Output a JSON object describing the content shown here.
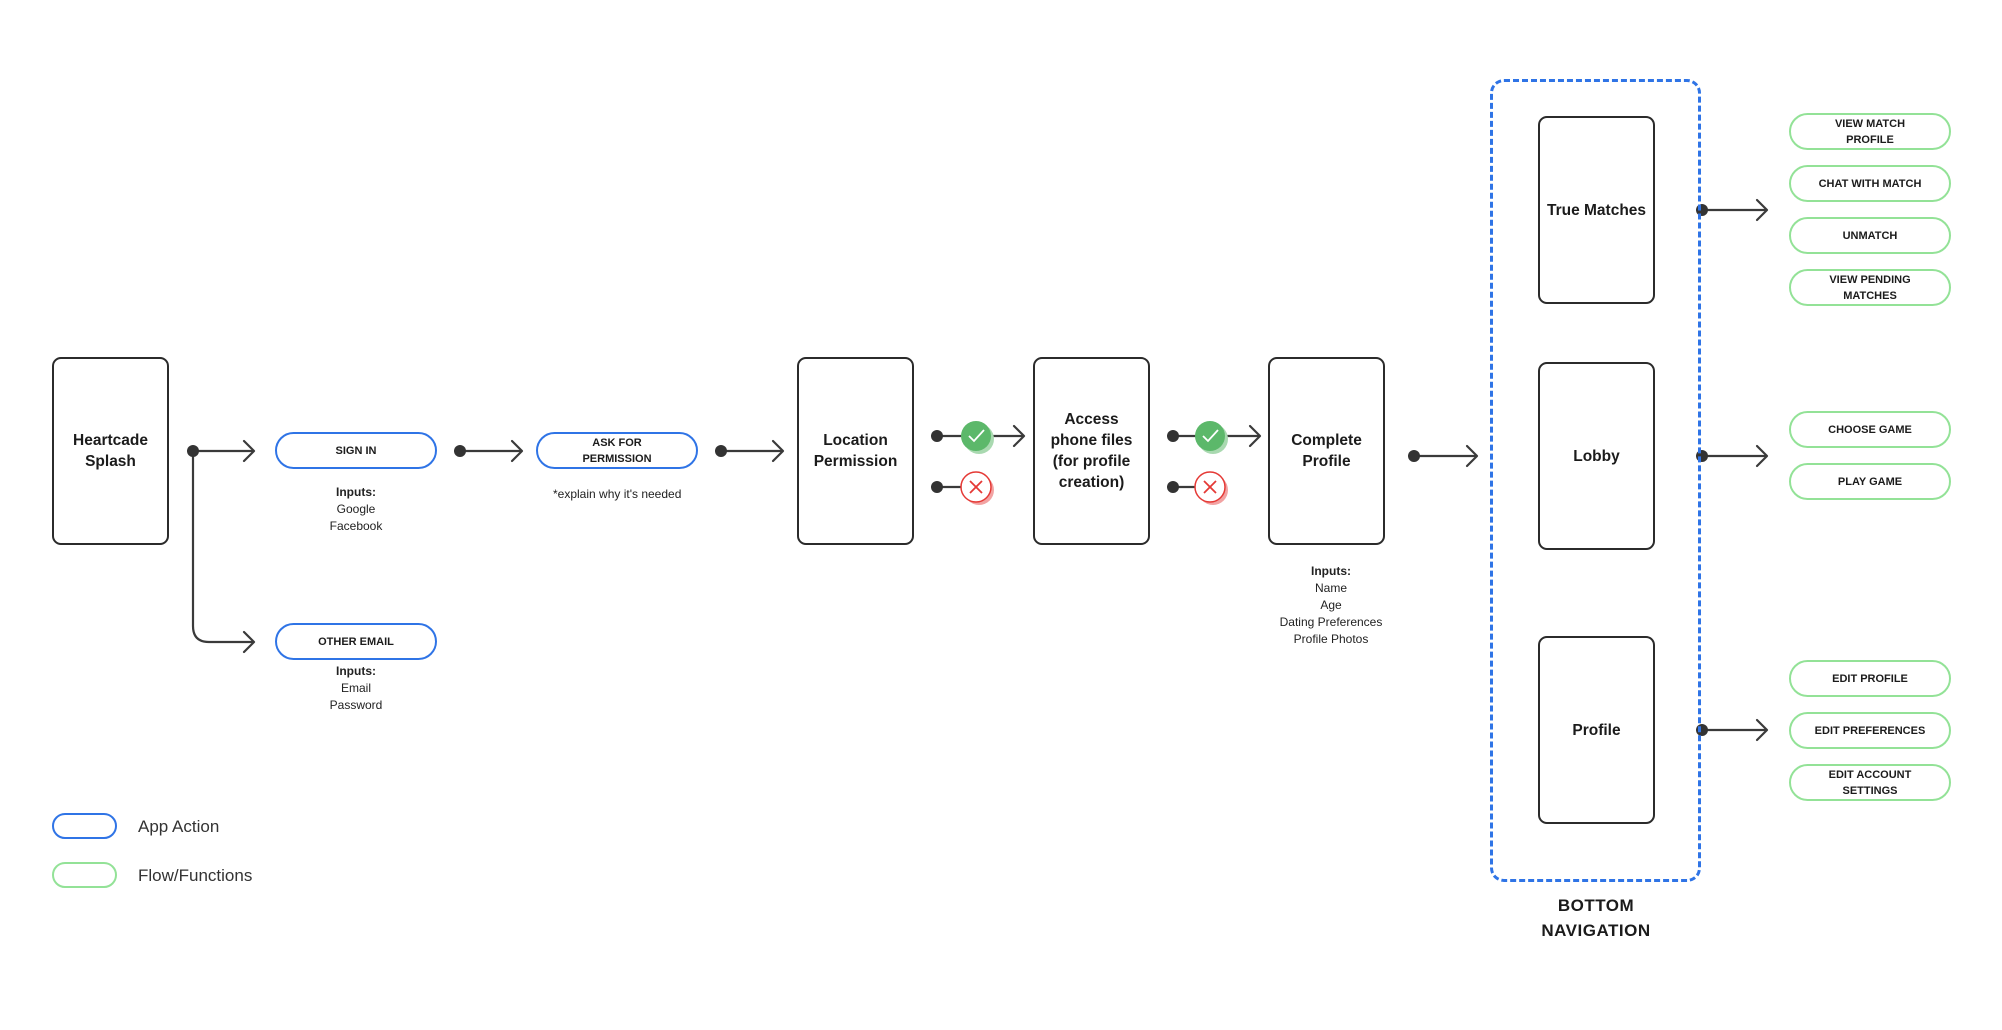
{
  "diagram": {
    "colors": {
      "app_action": "#2f74e6",
      "flow_functions": "#93e297",
      "connector": "#3a3a3a",
      "accept": "#5cb86a",
      "reject": "#e53935"
    },
    "screens": {
      "splash": "Heartcade Splash",
      "location": "Location Permission",
      "access_files": "Access phone files (for profile creation)",
      "complete_profile": "Complete Profile",
      "true_matches": "True Matches",
      "lobby": "Lobby",
      "profile": "Profile"
    },
    "app_actions": {
      "sign_in": "SIGN IN",
      "other_email": "OTHER EMAIL",
      "ask_permission": "ASK FOR PERMISSION"
    },
    "notes": {
      "ask_permission_note": "*explain why it's needed"
    },
    "inputs": {
      "sign_in": {
        "heading": "Inputs:",
        "items": [
          "Google",
          "Facebook"
        ]
      },
      "other_email": {
        "heading": "Inputs:",
        "items": [
          "Email",
          "Password"
        ]
      },
      "complete_profile": {
        "heading": "Inputs:",
        "items": [
          "Name",
          "Age",
          "Dating Preferences",
          "Profile Photos"
        ]
      }
    },
    "decisions": {
      "accept_icon": "check-icon",
      "reject_icon": "x-icon"
    },
    "bottom_navigation": {
      "label_line1": "BOTTOM",
      "label_line2": "NAVIGATION"
    },
    "functions": {
      "true_matches": [
        "VIEW MATCH PROFILE",
        "CHAT WITH MATCH",
        "UNMATCH",
        "VIEW PENDING MATCHES"
      ],
      "lobby": [
        "CHOOSE GAME",
        "PLAY GAME"
      ],
      "profile": [
        "EDIT PROFILE",
        "EDIT PREFERENCES",
        "EDIT ACCOUNT SETTINGS"
      ]
    },
    "legend": [
      {
        "label": "App Action"
      },
      {
        "label": "Flow/Functions"
      }
    ]
  }
}
